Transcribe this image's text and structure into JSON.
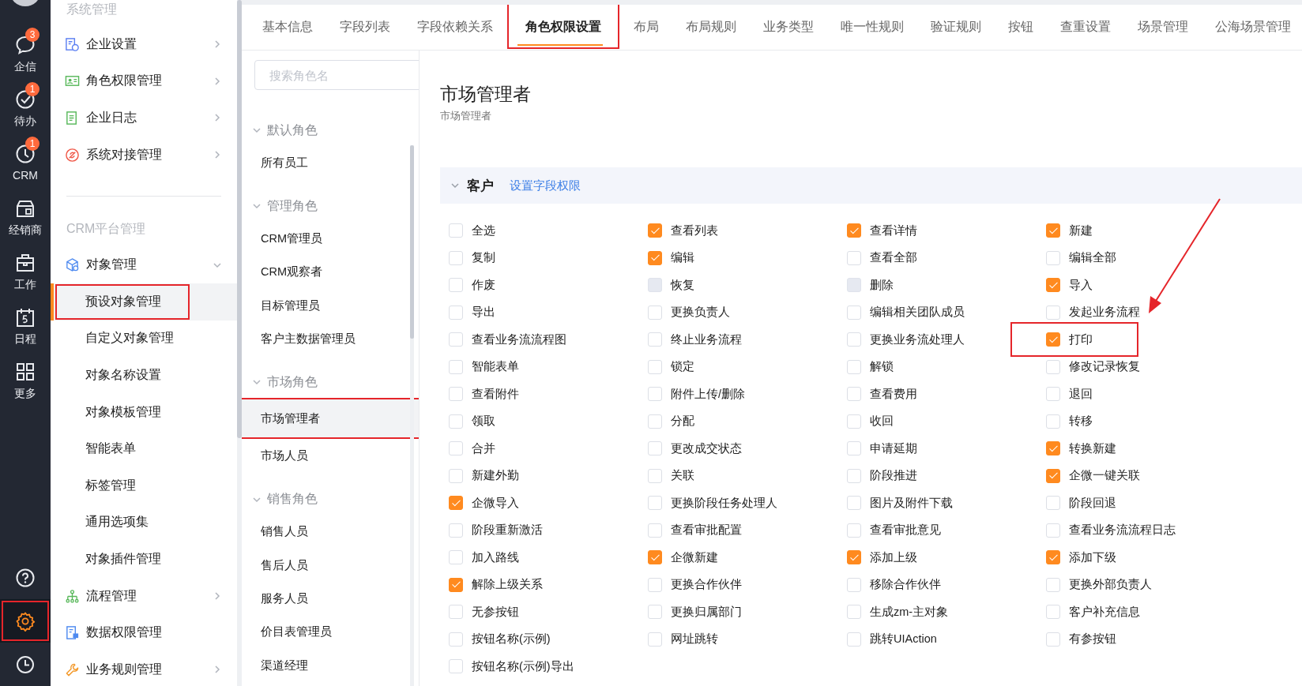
{
  "rail": {
    "items": [
      {
        "label": "企信",
        "badge": "3"
      },
      {
        "label": "待办",
        "badge": "1"
      },
      {
        "label": "CRM",
        "badge": "1"
      },
      {
        "label": "经销商"
      },
      {
        "label": "工作"
      },
      {
        "label": "日程"
      },
      {
        "label": "更多"
      }
    ],
    "bottom_items": [
      {
        "selected": false,
        "highlighted": false
      },
      {
        "selected": true,
        "highlighted": true
      },
      {
        "selected": false,
        "highlighted": false
      }
    ]
  },
  "sidebar": {
    "sections": [
      {
        "title": "系统管理",
        "items": [
          {
            "label": "企业设置",
            "kind": "group",
            "expanded": false
          },
          {
            "label": "角色权限管理",
            "kind": "group",
            "expanded": false
          },
          {
            "label": "企业日志",
            "kind": "group",
            "expanded": false
          },
          {
            "label": "系统对接管理",
            "kind": "group",
            "expanded": false
          }
        ]
      },
      {
        "title": "CRM平台管理",
        "items": [
          {
            "label": "对象管理",
            "kind": "group",
            "expanded": true,
            "children": [
              {
                "label": "预设对象管理",
                "selected": true,
                "highlighted": true
              },
              {
                "label": "自定义对象管理",
                "selected": false,
                "highlighted": false
              },
              {
                "label": "对象名称设置",
                "selected": false,
                "highlighted": false
              },
              {
                "label": "对象模板管理",
                "selected": false,
                "highlighted": false
              },
              {
                "label": "智能表单",
                "selected": false,
                "highlighted": false
              },
              {
                "label": "标签管理",
                "selected": false,
                "highlighted": false
              },
              {
                "label": "通用选项集",
                "selected": false,
                "highlighted": false
              },
              {
                "label": "对象插件管理",
                "selected": false,
                "highlighted": false
              }
            ]
          },
          {
            "label": "流程管理",
            "kind": "group",
            "expanded": false
          },
          {
            "label": "数据权限管理",
            "kind": "link",
            "expanded": false
          },
          {
            "label": "业务规则管理",
            "kind": "group",
            "expanded": false
          }
        ]
      }
    ]
  },
  "tabs": [
    {
      "label": "基本信息",
      "selected": false,
      "highlighted": false
    },
    {
      "label": "字段列表",
      "selected": false,
      "highlighted": false
    },
    {
      "label": "字段依赖关系",
      "selected": false,
      "highlighted": false
    },
    {
      "label": "角色权限设置",
      "selected": true,
      "highlighted": true
    },
    {
      "label": "布局",
      "selected": false,
      "highlighted": false
    },
    {
      "label": "布局规则",
      "selected": false,
      "highlighted": false
    },
    {
      "label": "业务类型",
      "selected": false,
      "highlighted": false
    },
    {
      "label": "唯一性规则",
      "selected": false,
      "highlighted": false
    },
    {
      "label": "验证规则",
      "selected": false,
      "highlighted": false
    },
    {
      "label": "按钮",
      "selected": false,
      "highlighted": false
    },
    {
      "label": "查重设置",
      "selected": false,
      "highlighted": false
    },
    {
      "label": "场景管理",
      "selected": false,
      "highlighted": false
    },
    {
      "label": "公海场景管理",
      "selected": false,
      "highlighted": false
    }
  ],
  "roles": {
    "search": {
      "placeholder": "搜索角色名"
    },
    "groups": [
      {
        "title": "默认角色",
        "expanded": true,
        "roles": [
          {
            "label": "所有员工",
            "selected": false,
            "highlighted": false
          }
        ]
      },
      {
        "title": "管理角色",
        "expanded": true,
        "roles": [
          {
            "label": "CRM管理员",
            "selected": false,
            "highlighted": false
          },
          {
            "label": "CRM观察者",
            "selected": false,
            "highlighted": false
          },
          {
            "label": "目标管理员",
            "selected": false,
            "highlighted": false
          },
          {
            "label": "客户主数据管理员",
            "selected": false,
            "highlighted": false
          }
        ]
      },
      {
        "title": "市场角色",
        "expanded": true,
        "roles": [
          {
            "label": "市场管理者",
            "selected": true,
            "highlighted": true
          },
          {
            "label": "市场人员",
            "selected": false,
            "highlighted": false
          }
        ]
      },
      {
        "title": "销售角色",
        "expanded": true,
        "roles": [
          {
            "label": "销售人员",
            "selected": false,
            "highlighted": false
          },
          {
            "label": "售后人员",
            "selected": false,
            "highlighted": false
          },
          {
            "label": "服务人员",
            "selected": false,
            "highlighted": false
          },
          {
            "label": "价目表管理员",
            "selected": false,
            "highlighted": false
          },
          {
            "label": "渠道经理",
            "selected": false,
            "highlighted": false
          }
        ]
      }
    ]
  },
  "main": {
    "title": "市场管理者",
    "subtitle": "市场管理者",
    "section": {
      "title": "客户",
      "expanded": true,
      "link": "设置字段权限",
      "permissions": [
        {
          "label": "全选",
          "checked": false,
          "disabled": false,
          "highlighted": false
        },
        {
          "label": "查看列表",
          "checked": true,
          "disabled": false,
          "highlighted": false
        },
        {
          "label": "查看详情",
          "checked": true,
          "disabled": false,
          "highlighted": false
        },
        {
          "label": "新建",
          "checked": true,
          "disabled": false,
          "highlighted": false
        },
        {
          "label": "复制",
          "checked": false,
          "disabled": false,
          "highlighted": false
        },
        {
          "label": "编辑",
          "checked": true,
          "disabled": false,
          "highlighted": false
        },
        {
          "label": "查看全部",
          "checked": false,
          "disabled": false,
          "highlighted": false
        },
        {
          "label": "编辑全部",
          "checked": false,
          "disabled": false,
          "highlighted": false
        },
        {
          "label": "作废",
          "checked": false,
          "disabled": false,
          "highlighted": false
        },
        {
          "label": "恢复",
          "checked": false,
          "disabled": true,
          "highlighted": false
        },
        {
          "label": "删除",
          "checked": false,
          "disabled": true,
          "highlighted": false
        },
        {
          "label": "导入",
          "checked": true,
          "disabled": false,
          "highlighted": false
        },
        {
          "label": "导出",
          "checked": false,
          "disabled": false,
          "highlighted": false
        },
        {
          "label": "更换负责人",
          "checked": false,
          "disabled": false,
          "highlighted": false
        },
        {
          "label": "编辑相关团队成员",
          "checked": false,
          "disabled": false,
          "highlighted": false
        },
        {
          "label": "发起业务流程",
          "checked": false,
          "disabled": false,
          "highlighted": false
        },
        {
          "label": "查看业务流流程图",
          "checked": false,
          "disabled": false,
          "highlighted": false
        },
        {
          "label": "终止业务流程",
          "checked": false,
          "disabled": false,
          "highlighted": false
        },
        {
          "label": "更换业务流处理人",
          "checked": false,
          "disabled": false,
          "highlighted": false
        },
        {
          "label": "打印",
          "checked": true,
          "disabled": false,
          "highlighted": true
        },
        {
          "label": "智能表单",
          "checked": false,
          "disabled": false,
          "highlighted": false
        },
        {
          "label": "锁定",
          "checked": false,
          "disabled": false,
          "highlighted": false
        },
        {
          "label": "解锁",
          "checked": false,
          "disabled": false,
          "highlighted": false
        },
        {
          "label": "修改记录恢复",
          "checked": false,
          "disabled": false,
          "highlighted": false
        },
        {
          "label": "查看附件",
          "checked": false,
          "disabled": false,
          "highlighted": false
        },
        {
          "label": "附件上传/删除",
          "checked": false,
          "disabled": false,
          "highlighted": false
        },
        {
          "label": "查看费用",
          "checked": false,
          "disabled": false,
          "highlighted": false
        },
        {
          "label": "退回",
          "checked": false,
          "disabled": false,
          "highlighted": false
        },
        {
          "label": "领取",
          "checked": false,
          "disabled": false,
          "highlighted": false
        },
        {
          "label": "分配",
          "checked": false,
          "disabled": false,
          "highlighted": false
        },
        {
          "label": "收回",
          "checked": false,
          "disabled": false,
          "highlighted": false
        },
        {
          "label": "转移",
          "checked": false,
          "disabled": false,
          "highlighted": false
        },
        {
          "label": "合并",
          "checked": false,
          "disabled": false,
          "highlighted": false
        },
        {
          "label": "更改成交状态",
          "checked": false,
          "disabled": false,
          "highlighted": false
        },
        {
          "label": "申请延期",
          "checked": false,
          "disabled": false,
          "highlighted": false
        },
        {
          "label": "转换新建",
          "checked": true,
          "disabled": false,
          "highlighted": false
        },
        {
          "label": "新建外勤",
          "checked": false,
          "disabled": false,
          "highlighted": false
        },
        {
          "label": "关联",
          "checked": false,
          "disabled": false,
          "highlighted": false
        },
        {
          "label": "阶段推进",
          "checked": false,
          "disabled": false,
          "highlighted": false
        },
        {
          "label": "企微一键关联",
          "checked": true,
          "disabled": false,
          "highlighted": false
        },
        {
          "label": "企微导入",
          "checked": true,
          "disabled": false,
          "highlighted": false
        },
        {
          "label": "更换阶段任务处理人",
          "checked": false,
          "disabled": false,
          "highlighted": false
        },
        {
          "label": "图片及附件下载",
          "checked": false,
          "disabled": false,
          "highlighted": false
        },
        {
          "label": "阶段回退",
          "checked": false,
          "disabled": false,
          "highlighted": false
        },
        {
          "label": "阶段重新激活",
          "checked": false,
          "disabled": false,
          "highlighted": false
        },
        {
          "label": "查看审批配置",
          "checked": false,
          "disabled": false,
          "highlighted": false
        },
        {
          "label": "查看审批意见",
          "checked": false,
          "disabled": false,
          "highlighted": false
        },
        {
          "label": "查看业务流流程日志",
          "checked": false,
          "disabled": false,
          "highlighted": false
        },
        {
          "label": "加入路线",
          "checked": false,
          "disabled": false,
          "highlighted": false
        },
        {
          "label": "企微新建",
          "checked": true,
          "disabled": false,
          "highlighted": false
        },
        {
          "label": "添加上级",
          "checked": true,
          "disabled": false,
          "highlighted": false
        },
        {
          "label": "添加下级",
          "checked": true,
          "disabled": false,
          "highlighted": false
        },
        {
          "label": "解除上级关系",
          "checked": true,
          "disabled": false,
          "highlighted": false
        },
        {
          "label": "更换合作伙伴",
          "checked": false,
          "disabled": false,
          "highlighted": false
        },
        {
          "label": "移除合作伙伴",
          "checked": false,
          "disabled": false,
          "highlighted": false
        },
        {
          "label": "更换外部负责人",
          "checked": false,
          "disabled": false,
          "highlighted": false
        },
        {
          "label": "无参按钮",
          "checked": false,
          "disabled": false,
          "highlighted": false
        },
        {
          "label": "更换归属部门",
          "checked": false,
          "disabled": false,
          "highlighted": false
        },
        {
          "label": "生成zm-主对象",
          "checked": false,
          "disabled": false,
          "highlighted": false
        },
        {
          "label": "客户补充信息",
          "checked": false,
          "disabled": false,
          "highlighted": false
        },
        {
          "label": "按钮名称(示例)",
          "checked": false,
          "disabled": false,
          "highlighted": false
        },
        {
          "label": "网址跳转",
          "checked": false,
          "disabled": false,
          "highlighted": false
        },
        {
          "label": "跳转UIAction",
          "checked": false,
          "disabled": false,
          "highlighted": false
        },
        {
          "label": "有参按钮",
          "checked": false,
          "disabled": false,
          "highlighted": false
        },
        {
          "label": "按钮名称(示例)导出",
          "checked": false,
          "disabled": false,
          "highlighted": false
        }
      ]
    }
  }
}
